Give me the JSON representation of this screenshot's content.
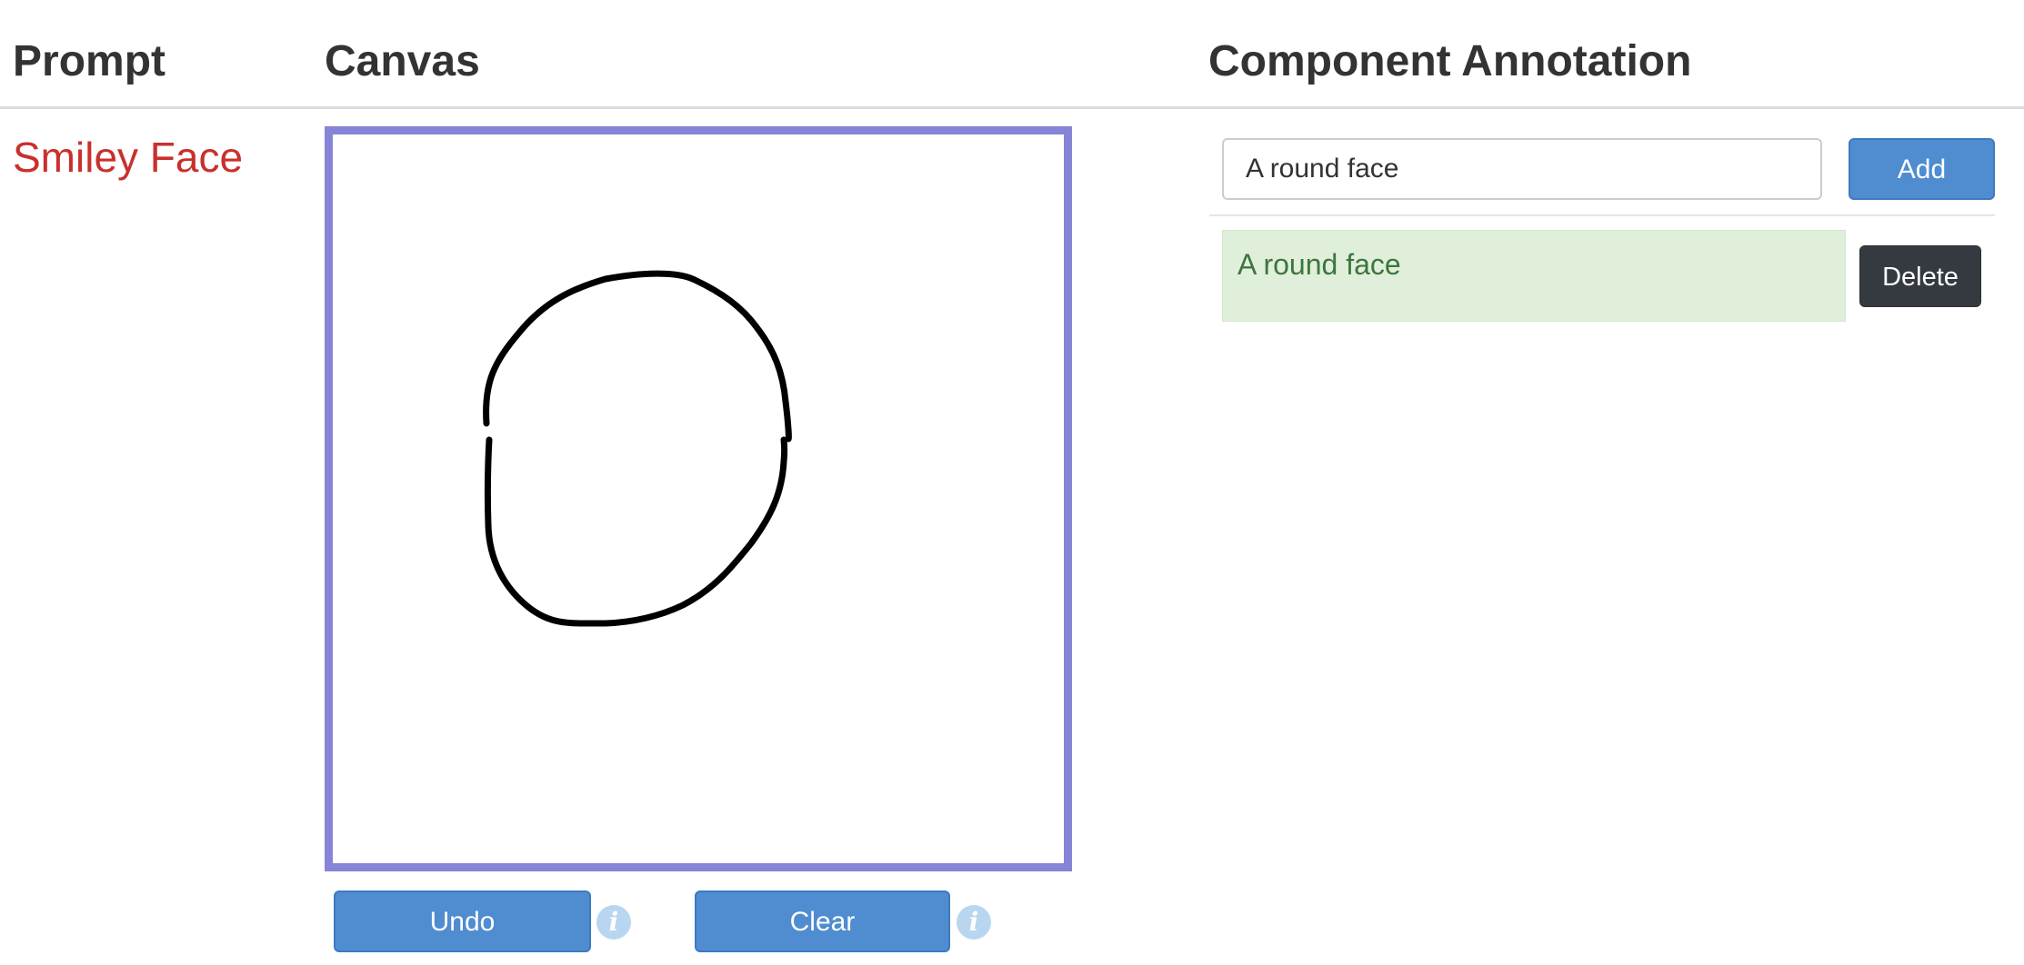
{
  "headers": {
    "prompt": "Prompt",
    "canvas": "Canvas",
    "annotation": "Component Annotation"
  },
  "prompt": {
    "text": "Smiley Face"
  },
  "canvas": {
    "border_color": "#8684d6",
    "stroke_color": "#000000"
  },
  "canvas_controls": {
    "undo_label": "Undo",
    "clear_label": "Clear",
    "info_icon_glyph": "i"
  },
  "annotation": {
    "input_value": "A round face",
    "add_label": "Add",
    "items": [
      {
        "label": "A round face",
        "delete_label": "Delete"
      }
    ]
  },
  "colors": {
    "prompt_text": "#c9302c",
    "primary_button": "#4f8cd0",
    "dark_button": "#343a40",
    "success_bg": "#e0efda",
    "success_text": "#3c763d"
  }
}
